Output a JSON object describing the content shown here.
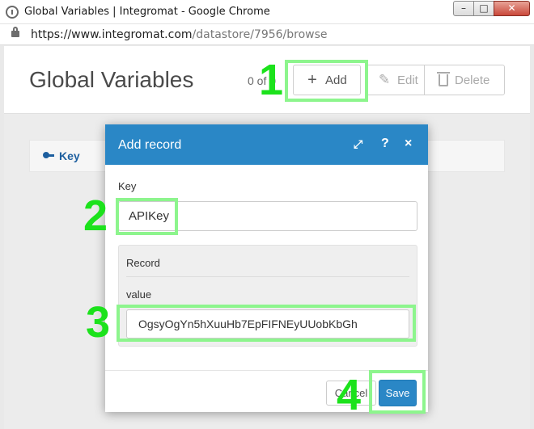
{
  "window": {
    "title": "Global Variables | Integromat - Google Chrome",
    "controls": {
      "minimize": "–",
      "maximize": "□",
      "close": "✕"
    }
  },
  "address": {
    "host": "https://www.integromat.com",
    "path": "/datastore/7956/browse"
  },
  "page": {
    "title": "Global Variables",
    "record_count": "0 of 0",
    "toolbar": {
      "add_label": "Add",
      "edit_label": "Edit",
      "delete_label": "Delete"
    },
    "table": {
      "columns": [
        "Key"
      ]
    }
  },
  "modal": {
    "title": "Add record",
    "header_icons": {
      "expand": "⤢",
      "help": "?",
      "close": "×"
    },
    "key_label": "Key",
    "key_value": "APIKey",
    "record_label": "Record",
    "value_label": "value",
    "value_value": "OgsyOgYn5hXuuHb7EpFIFNEyUUobKbGh",
    "cancel_label": "Cancel",
    "save_label": "Save"
  },
  "annotations": {
    "steps": [
      "1",
      "2",
      "3",
      "4"
    ],
    "highlight_color": "#8df58d",
    "number_color": "#1ce21c"
  },
  "icons": [
    "app-icon",
    "lock-icon",
    "plus-icon",
    "edit-icon",
    "trash-icon",
    "key-icon",
    "expand-icon",
    "help-icon",
    "close-icon"
  ],
  "colors": {
    "accent": "#2a87c6",
    "key_column": "#1d5f9f"
  }
}
